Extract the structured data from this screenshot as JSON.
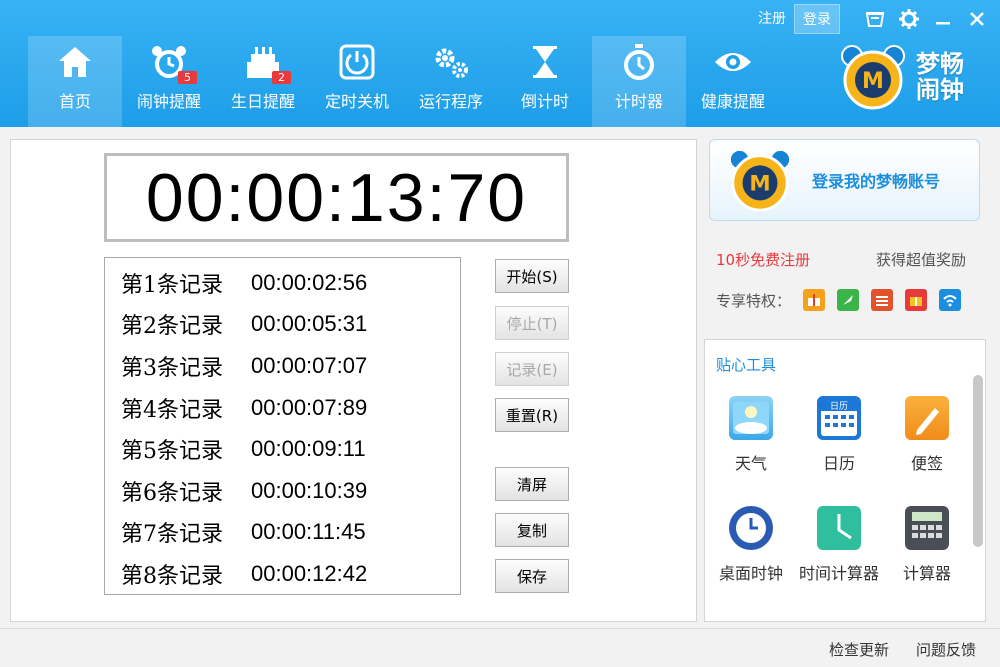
{
  "topbar": {
    "register": "注册",
    "login": "登录"
  },
  "nav": [
    {
      "label": "首页",
      "icon": "home-icon",
      "active": true
    },
    {
      "label": "闹钟提醒",
      "icon": "alarm-clock-icon",
      "badge": "5"
    },
    {
      "label": "生日提醒",
      "icon": "birthday-cake-icon",
      "badge": "2"
    },
    {
      "label": "定时关机",
      "icon": "power-icon"
    },
    {
      "label": "运行程序",
      "icon": "gears-icon"
    },
    {
      "label": "倒计时",
      "icon": "hourglass-icon"
    },
    {
      "label": "计时器",
      "icon": "stopwatch-icon",
      "active": true
    },
    {
      "label": "健康提醒",
      "icon": "eye-icon"
    }
  ],
  "brand": {
    "title": "梦畅闹钟",
    "logo_letter": "M"
  },
  "timer": {
    "display": "00:00:13:70"
  },
  "records": [
    {
      "label": "第1条记录",
      "time": "00:00:02:56"
    },
    {
      "label": "第2条记录",
      "time": "00:00:05:31"
    },
    {
      "label": "第3条记录",
      "time": "00:00:07:07"
    },
    {
      "label": "第4条记录",
      "time": "00:00:07:89"
    },
    {
      "label": "第5条记录",
      "time": "00:00:09:11"
    },
    {
      "label": "第6条记录",
      "time": "00:00:10:39"
    },
    {
      "label": "第7条记录",
      "time": "00:00:11:45"
    },
    {
      "label": "第8条记录",
      "time": "00:00:12:42"
    }
  ],
  "buttons": {
    "start": "开始(S)",
    "stop": "停止(T)",
    "record": "记录(E)",
    "reset": "重置(R)",
    "clear": "清屏",
    "copy": "复制",
    "save": "保存"
  },
  "login_panel": {
    "text": "登录我的梦畅账号"
  },
  "promo": {
    "register_free": "10秒免费注册",
    "reward": "获得超值奖励",
    "privileges_label": "专享特权："
  },
  "tools": {
    "title": "贴心工具",
    "items": [
      {
        "label": "天气",
        "icon": "weather-icon"
      },
      {
        "label": "日历",
        "icon": "calendar-icon",
        "icon_text": "日历"
      },
      {
        "label": "便签",
        "icon": "note-icon"
      },
      {
        "label": "桌面时钟",
        "icon": "desktop-clock-icon"
      },
      {
        "label": "时间计算器",
        "icon": "time-calculator-icon"
      },
      {
        "label": "计算器",
        "icon": "calculator-icon"
      }
    ]
  },
  "footer": {
    "check_update": "检查更新",
    "feedback": "问题反馈"
  },
  "colors": {
    "header": "#1d9ee8",
    "accent": "#1b8ee0",
    "red": "#e8393d"
  }
}
